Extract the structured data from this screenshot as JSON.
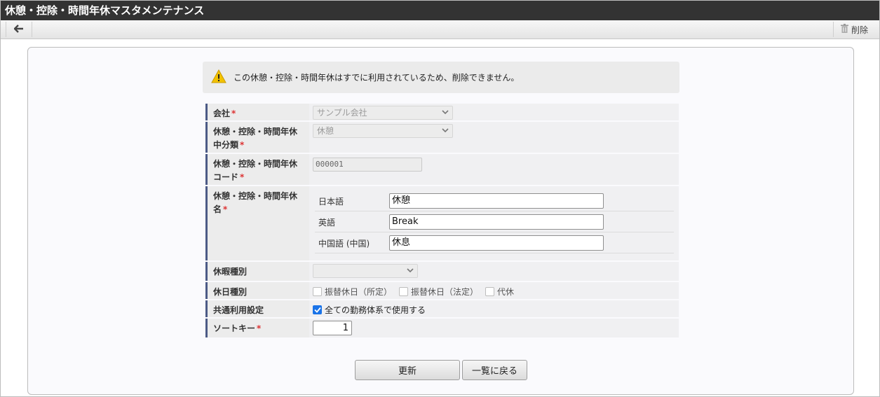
{
  "window": {
    "title": "休憩・控除・時間年休マスタメンテナンス"
  },
  "toolbar": {
    "delete_label": "削除"
  },
  "warning": {
    "message": "この休憩・控除・時間年休はすでに利用されているため、削除できません。"
  },
  "form": {
    "required_mark": "*",
    "company": {
      "label": "会社",
      "value": "サンプル会社"
    },
    "category": {
      "label_line1": "休憩・控除・時間年休",
      "label_line2": "中分類",
      "value": "休憩"
    },
    "code": {
      "label_line1": "休憩・控除・時間年休",
      "label_line2": "コード",
      "value": "000001"
    },
    "name": {
      "label_line1": "休憩・控除・時間年休",
      "label_line2": "名",
      "languages": [
        {
          "label": "日本語",
          "value": "休憩"
        },
        {
          "label": "英語",
          "value": "Break"
        },
        {
          "label": "中国語 (中国)",
          "value": "休息"
        }
      ]
    },
    "leave_type": {
      "label": "休暇種別",
      "value": ""
    },
    "holiday_type": {
      "label": "休日種別",
      "options": [
        {
          "label": "振替休日（所定）",
          "checked": false
        },
        {
          "label": "振替休日（法定）",
          "checked": false
        },
        {
          "label": "代休",
          "checked": false
        }
      ]
    },
    "shared_setting": {
      "label": "共通利用設定",
      "option_label": "全ての勤務体系で使用する",
      "checked": true
    },
    "sort_key": {
      "label": "ソートキー",
      "value": "1"
    }
  },
  "buttons": {
    "update": "更新",
    "back_to_list": "一覧に戻る"
  },
  "colors": {
    "title_bar": "#333333",
    "label_accent": "#4c5a86",
    "required": "#dd3333",
    "checkbox_on": "#1a73e8",
    "warning_icon": "#f2c200"
  },
  "icons": {
    "back": "arrow-left-icon",
    "delete": "trash-icon",
    "warning": "warning-icon",
    "dropdown": "chevron-down-icon"
  }
}
